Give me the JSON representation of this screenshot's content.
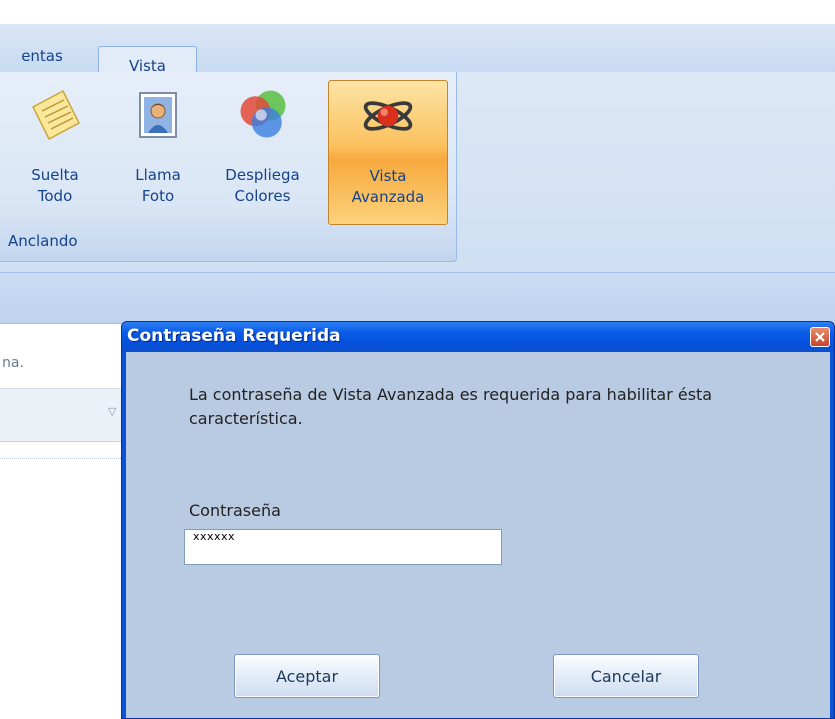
{
  "tabs": [
    {
      "label": "entas",
      "active": false
    },
    {
      "label": "Vista",
      "active": true
    }
  ],
  "ribbon": {
    "group_label": "Anclando",
    "buttons": [
      {
        "label": "Suelta\nTodo",
        "icon": "note-icon"
      },
      {
        "label": "Llama\nFoto",
        "icon": "photo-icon"
      },
      {
        "label": "Despliega\nColores",
        "icon": "color-circles-icon"
      },
      {
        "label": "Vista\nAvanzada",
        "icon": "advanced-view-icon",
        "selected": true
      }
    ]
  },
  "background": {
    "fragment_text": "na."
  },
  "dialog": {
    "title": "Contraseña Requerida",
    "message": "La contraseña de Vista Avanzada es requerida para habilitar ésta característica.",
    "password_label": "Contraseña",
    "password_value": "xxxxxx",
    "ok_label": "Aceptar",
    "cancel_label": "Cancelar"
  },
  "colors": {
    "titlebar": "#0a5ce6",
    "dialog_body": "#b9cbe3",
    "ribbon": "#dae6f5",
    "selected_button": "#fbc15f"
  }
}
